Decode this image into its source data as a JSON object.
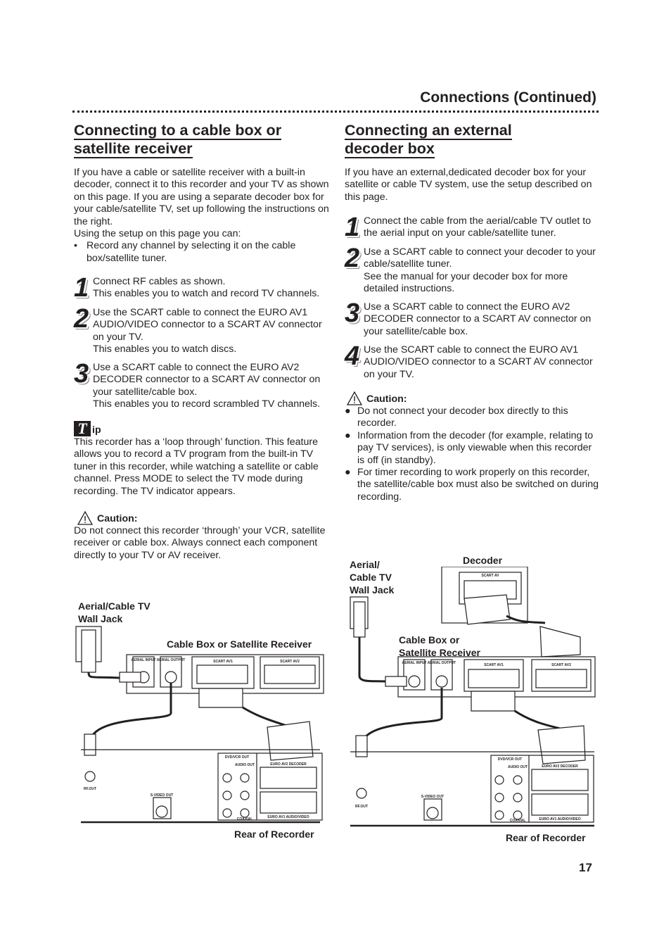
{
  "header": {
    "section_title": "Connections (Continued)"
  },
  "left": {
    "title_line1": "Connecting to a cable box or",
    "title_line2": "satellite receiver",
    "intro": "If you have a cable or satellite receiver with a built-in decoder, connect it to this recorder and your TV as shown on this page. If you are using a separate decoder box for your cable/satellite TV, set up following the instructions on the right.",
    "intro2": "Using the setup on this page you can:",
    "bullet": "Record any channel by selecting it on the cable box/satellite tuner.",
    "steps": [
      {
        "num": "1",
        "text": "Connect RF cables as shown.",
        "sub": "This enables you to watch and record TV channels."
      },
      {
        "num": "2",
        "text": "Use the SCART cable to connect the EURO AV1 AUDIO/VIDEO connector to a SCART AV connector on your TV.",
        "sub": "This enables you to watch discs."
      },
      {
        "num": "3",
        "text": "Use a SCART cable to connect the EURO AV2 DECODER connector to a SCART AV connector on your satellite/cable box.",
        "sub": "This enables you to record scrambled TV channels."
      }
    ],
    "tip_title": "ip",
    "tip_text": "This recorder has a ‘loop through’ function. This feature allows you to record a TV program from the built-in TV tuner in this recorder, while watching a satellite or cable channel. Press MODE to select the TV mode during recording. The TV indicator appears.",
    "caution_title": "Caution:",
    "caution_text": "Do not connect this recorder ‘through’ your VCR, satellite receiver or cable box. Always connect each component directly to your TV or AV receiver."
  },
  "right": {
    "title_line1": "Connecting an external",
    "title_line2": "decoder box",
    "intro": "If you have an external,dedicated decoder box for your satellite or cable TV system, use the setup described on this page.",
    "steps": [
      {
        "num": "1",
        "text": "Connect the cable from the aerial/cable TV outlet to the aerial input on your cable/satellite tuner.",
        "sub": ""
      },
      {
        "num": "2",
        "text": "Use a SCART cable to connect your decoder to your cable/satellite tuner.",
        "sub": "See the manual for your decoder box for more detailed instructions."
      },
      {
        "num": "3",
        "text": "Use a SCART cable to connect the EURO AV2 DECODER connector to a SCART AV connector on your satellite/cable box.",
        "sub": ""
      },
      {
        "num": "4",
        "text": "Use the SCART cable to connect the EURO AV1 AUDIO/VIDEO connector to a SCART AV connector on your TV.",
        "sub": ""
      }
    ],
    "caution_title": "Caution:",
    "caution_items": [
      "Do not connect your decoder box directly to this recorder.",
      "Information from the decoder (for example, relating to pay TV services), is only viewable when this recorder is off (in standby).",
      "For timer recording to work properly on this recorder, the satellite/cable box must also be switched on during recording."
    ]
  },
  "diagram_left": {
    "wall_jack": "Aerial/Cable TV Wall Jack",
    "wall_jack_l1": "Aerial/Cable TV",
    "wall_jack_l2": "Wall Jack",
    "receiver": "Cable Box or Satellite Receiver",
    "rear": "Rear of Recorder"
  },
  "diagram_right": {
    "wall_jack_l1": "Aerial/",
    "wall_jack_l2": "Cable TV",
    "wall_jack_l3": "Wall Jack",
    "decoder": "Decoder",
    "receiver_l1": "Cable Box or",
    "receiver_l2": "Satellite Receiver",
    "rear": "Rear of Recorder"
  },
  "device_labels": {
    "aerial_input": "AERIAL INPUT",
    "aerial_output": "AERIAL OUTPUT",
    "scart_av1": "SCART AV1",
    "scart_av2": "SCART AV2",
    "scart_av": "SCART AV",
    "dvd_vcr_out": "DVD/VCR OUT",
    "audio_out": "AUDIO OUT",
    "coaxial": "COAXIAL",
    "svideo_out": "S-VIDEO OUT",
    "rf_out": "RF.OUT",
    "euro_av2": "EURO AV2 DECODER",
    "euro_av1": "EURO AV1 AUDIO/VIDEO"
  },
  "footer": {
    "page_number": "17"
  }
}
